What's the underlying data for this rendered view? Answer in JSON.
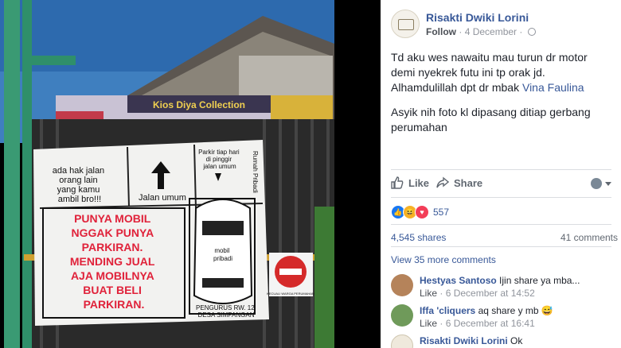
{
  "post": {
    "author": "Risakti Dwiki Lorini",
    "follow": "Follow",
    "date": "4 December",
    "text_line1": "Td aku wes nawaitu mau turun dr motor demi nyekrek futu ini tp orak jd. Alhamdulillah dpt dr mbak ",
    "mention": "Vina Faulina",
    "text_line2": "Asyik nih foto kl dipasang ditiap gerbang perumahan"
  },
  "actions": {
    "like": "Like",
    "share": "Share"
  },
  "stats": {
    "reaction_count": "557",
    "shares": "4,545 shares",
    "comments": "41 comments",
    "view_more": "View 35 more comments"
  },
  "comments": [
    {
      "name": "Hestyas Santoso",
      "text": "Ijin share ya mba...",
      "like": "Like",
      "date": "6 December at 14:52"
    },
    {
      "name": "Iffa 'cliquers",
      "text": "aq share y mb 😅",
      "like": "Like",
      "date": "6 December at 16:41"
    },
    {
      "name": "Risakti Dwiki Lorini",
      "text": "Ok",
      "like": "",
      "date": ""
    }
  ],
  "photo": {
    "shop_sign": "Kios Diya Collection",
    "banner_top_left": "ada hak jalan orang lain yang kamu ambil bro!!!",
    "arrow_label": "Jalan umum",
    "parking_note": "Parkir tiap hari di pinggir jalan umum",
    "house_label": "Rumah Pribadi",
    "car_label": "mobil pribadi",
    "main_message": [
      "PUNYA MOBIL",
      "NGGAK PUNYA",
      "PARKIRAN.",
      "MENDING JUAL",
      "AJA MOBILNYA",
      "BUAT BELI",
      "PARKIRAN."
    ],
    "signature_1": "PENGURUS RW. 12",
    "signature_2": "DESA SIMPANGAN",
    "small_sign": "KECUALI WARGA PERUMAHAN"
  },
  "colors": {
    "link": "#385898",
    "banner_red": "#e0223a",
    "gate_green": "#2f8f6a"
  }
}
